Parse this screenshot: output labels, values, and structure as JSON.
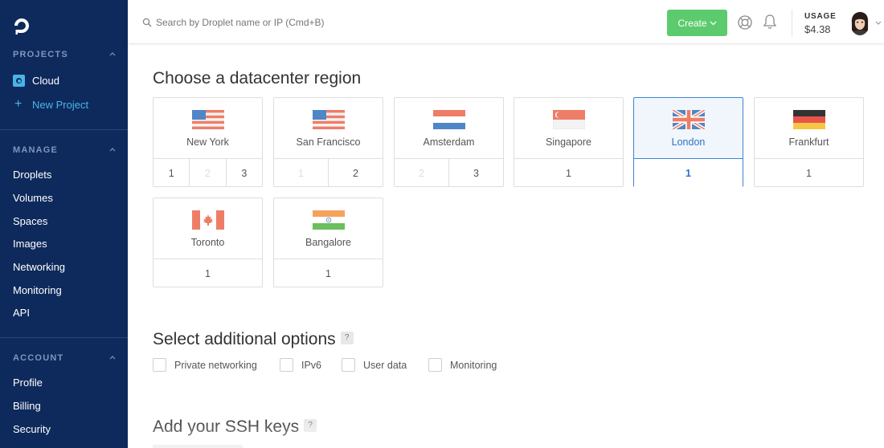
{
  "search": {
    "placeholder": "Search by Droplet name or IP (Cmd+B)"
  },
  "header": {
    "create_label": "Create",
    "usage_label": "USAGE",
    "usage_value": "$4.38"
  },
  "sidebar": {
    "projects": {
      "title": "PROJECTS",
      "items": [
        {
          "label": "Cloud",
          "icon": "cloud-project-icon"
        },
        {
          "label": "New Project",
          "icon": "plus-icon"
        }
      ]
    },
    "manage": {
      "title": "MANAGE",
      "items": [
        "Droplets",
        "Volumes",
        "Spaces",
        "Images",
        "Networking",
        "Monitoring",
        "API"
      ]
    },
    "account": {
      "title": "ACCOUNT",
      "items": [
        "Profile",
        "Billing",
        "Security"
      ]
    }
  },
  "main": {
    "region_heading": "Choose a datacenter region",
    "regions": [
      {
        "name": "New York",
        "flag": "us-flag",
        "numbers": [
          "1",
          "2",
          "3"
        ],
        "disabled": [
          false,
          true,
          false
        ],
        "selected": false
      },
      {
        "name": "San Francisco",
        "flag": "us-flag",
        "numbers": [
          "1",
          "2"
        ],
        "disabled": [
          true,
          false
        ],
        "selected": false
      },
      {
        "name": "Amsterdam",
        "flag": "nl-flag",
        "numbers": [
          "2",
          "3"
        ],
        "disabled": [
          true,
          false
        ],
        "selected": false
      },
      {
        "name": "Singapore",
        "flag": "sg-flag",
        "numbers": [
          "1"
        ],
        "disabled": [
          false
        ],
        "selected": false
      },
      {
        "name": "London",
        "flag": "uk-flag",
        "numbers": [
          "1"
        ],
        "disabled": [
          false
        ],
        "selected": true
      },
      {
        "name": "Frankfurt",
        "flag": "de-flag",
        "numbers": [
          "1"
        ],
        "disabled": [
          false
        ],
        "selected": false
      },
      {
        "name": "Toronto",
        "flag": "ca-flag",
        "numbers": [
          "1"
        ],
        "disabled": [
          false
        ],
        "selected": false
      },
      {
        "name": "Bangalore",
        "flag": "in-flag",
        "numbers": [
          "1"
        ],
        "disabled": [
          false
        ],
        "selected": false
      }
    ],
    "options_heading": "Select additional options",
    "options": [
      "Private networking",
      "IPv6",
      "User data",
      "Monitoring"
    ],
    "ssh_heading": "Add your SSH keys",
    "help_mark": "?"
  },
  "colors": {
    "sidebar_bg": "#0e2a5c",
    "accent_blue": "#3d85d1",
    "create_green": "#5ccb6e",
    "sidebar_link": "#49b5e7"
  }
}
